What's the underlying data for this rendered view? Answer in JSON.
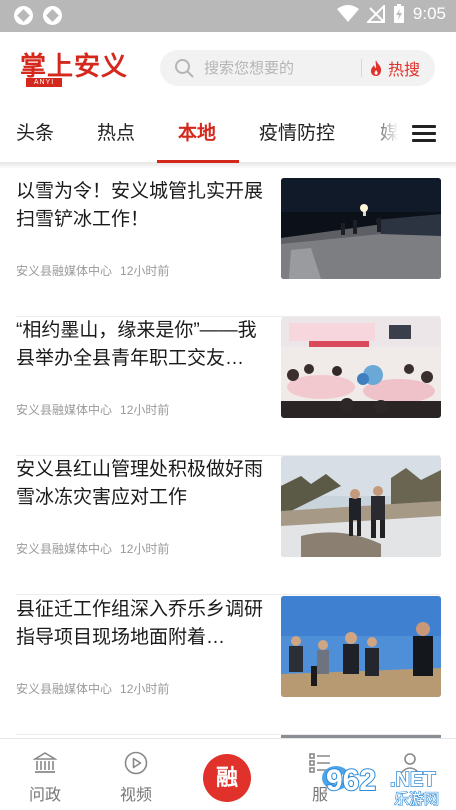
{
  "status_bar": {
    "time": "9:05"
  },
  "header": {
    "logo_text": "掌上安义",
    "logo_sub": "ANYI",
    "search_placeholder": "搜索您想要的",
    "hot_label": "热搜"
  },
  "tabs": [
    {
      "label": "头条",
      "active": false
    },
    {
      "label": "热点",
      "active": false
    },
    {
      "label": "本地",
      "active": true
    },
    {
      "label": "疫情防控",
      "active": false
    },
    {
      "label": "媒",
      "active": false
    }
  ],
  "news": [
    {
      "title": "以雪为令！安义城管扎实开展扫雪铲冰工作！",
      "source": "安义县融媒体中心",
      "time": "12小时前",
      "image": "night-snow-road-photo"
    },
    {
      "title": "“相约墨山，缘来是你”——我县举办全县青年职工交友…",
      "source": "安义县融媒体中心",
      "time": "12小时前",
      "image": "banquet-hall-event-photo"
    },
    {
      "title": "安义县红山管理处积极做好雨雪冰冻灾害应对工作",
      "source": "安义县融媒体中心",
      "time": "12小时前",
      "image": "snowy-hillside-inspection-photo"
    },
    {
      "title": "县征迁工作组深入乔乐乡调研指导项目现场地面附着…",
      "source": "安义县融媒体中心",
      "time": "12小时前",
      "image": "field-site-visit-photo"
    }
  ],
  "bottom_nav": [
    {
      "label": "问政",
      "icon": "government-building-icon"
    },
    {
      "label": "视频",
      "icon": "play-circle-icon"
    },
    {
      "label": "融",
      "icon": "rong-center-button"
    },
    {
      "label": "服",
      "icon": "service-list-icon"
    },
    {
      "label": "",
      "icon": "user-icon"
    }
  ],
  "watermark": {
    "text": "962.NET",
    "sub": "乐游网"
  },
  "colors": {
    "accent": "#d4281c",
    "hot": "#e0312a",
    "meta": "#9a9a9a"
  }
}
